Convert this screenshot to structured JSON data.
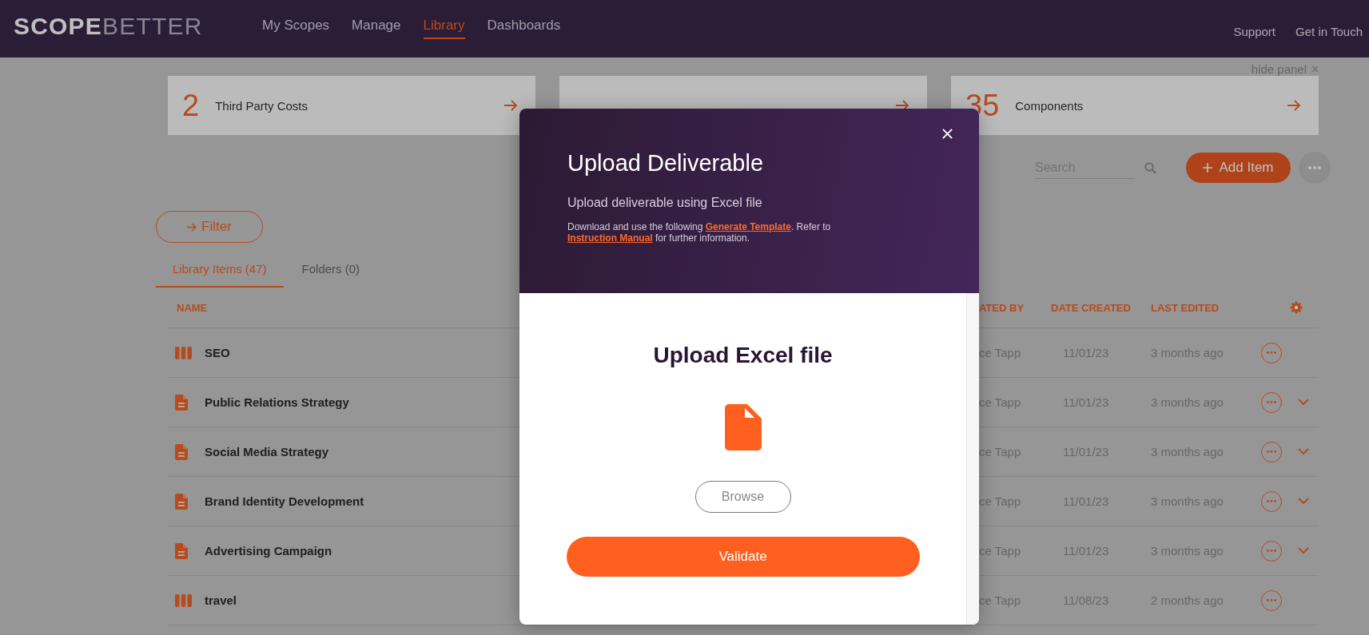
{
  "header": {
    "logo": "**SCOPE**BETTER",
    "nav": [
      {
        "label": "My Scopes",
        "selected": false
      },
      {
        "label": "Manage",
        "selected": false
      },
      {
        "label": "Library",
        "selected": true
      },
      {
        "label": "Dashboards",
        "selected": false
      }
    ],
    "links": [
      "Support",
      "Get in Touch"
    ]
  },
  "panel": {
    "hide_label": "hide panel",
    "cards": [
      {
        "count": "2",
        "label": "Third Party Costs"
      },
      {
        "covered": true
      },
      {
        "count": "35",
        "label": "Components"
      }
    ]
  },
  "toolbar": {
    "search": {
      "placeholder": "Search"
    },
    "add_button": "Add Item"
  },
  "filter_button": "Filter",
  "tabs": [
    {
      "label": "Library Items (47)",
      "selected": true
    },
    {
      "label": "Folders (0)",
      "selected": false
    }
  ],
  "table": {
    "columns": [
      "NAME",
      "ATED BY",
      "DATE CREATED",
      "LAST EDITED"
    ],
    "rows": [
      {
        "kind": "group",
        "name": "SEO",
        "created_by": "ce Tapp",
        "date_created": "11/01/23",
        "last_edited": "3 months ago",
        "has_children": false
      },
      {
        "kind": "document",
        "name": "Public Relations Strategy",
        "created_by": "ce Tapp",
        "date_created": "11/01/23",
        "last_edited": "3 months ago",
        "has_children": true
      },
      {
        "kind": "document",
        "name": "Social Media Strategy",
        "created_by": "ce Tapp",
        "date_created": "11/01/23",
        "last_edited": "3 months ago",
        "has_children": true
      },
      {
        "kind": "document",
        "name": "Brand Identity Development",
        "created_by": "ce Tapp",
        "date_created": "11/01/23",
        "last_edited": "3 months ago",
        "has_children": true
      },
      {
        "kind": "document",
        "name": "Advertising Campaign",
        "created_by": "ce Tapp",
        "date_created": "11/01/23",
        "last_edited": "3 months ago",
        "has_children": true
      },
      {
        "kind": "group",
        "name": "travel",
        "created_by": "ce Tapp",
        "date_created": "11/08/23",
        "last_edited": "2 months ago",
        "has_children": false
      }
    ]
  },
  "modal": {
    "title": "Upload Deliverable",
    "subtitle": "Upload deliverable using Excel file",
    "note": [
      {
        "text": "Download and use the following ",
        "link": false
      },
      {
        "text": "Generate Template",
        "link": true
      },
      {
        "text": ". Refer to ",
        "link": false
      },
      {
        "text": "Instruction Manual",
        "link": true
      },
      {
        "text": " for further information.",
        "link": false
      }
    ],
    "upload_heading": "Upload Excel file",
    "browse_button": "Browse",
    "validate_button": "Validate"
  }
}
